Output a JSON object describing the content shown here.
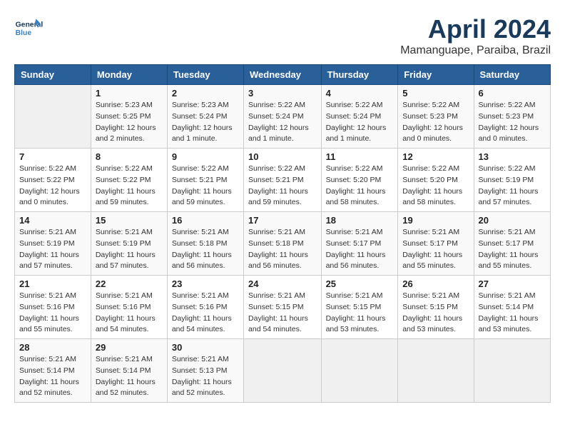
{
  "header": {
    "logo_general": "General",
    "logo_blue": "Blue",
    "month": "April 2024",
    "location": "Mamanguape, Paraiba, Brazil"
  },
  "columns": [
    "Sunday",
    "Monday",
    "Tuesday",
    "Wednesday",
    "Thursday",
    "Friday",
    "Saturday"
  ],
  "weeks": [
    [
      {
        "day": "",
        "sunrise": "",
        "sunset": "",
        "daylight": ""
      },
      {
        "day": "1",
        "sunrise": "Sunrise: 5:23 AM",
        "sunset": "Sunset: 5:25 PM",
        "daylight": "Daylight: 12 hours and 2 minutes."
      },
      {
        "day": "2",
        "sunrise": "Sunrise: 5:23 AM",
        "sunset": "Sunset: 5:24 PM",
        "daylight": "Daylight: 12 hours and 1 minute."
      },
      {
        "day": "3",
        "sunrise": "Sunrise: 5:22 AM",
        "sunset": "Sunset: 5:24 PM",
        "daylight": "Daylight: 12 hours and 1 minute."
      },
      {
        "day": "4",
        "sunrise": "Sunrise: 5:22 AM",
        "sunset": "Sunset: 5:24 PM",
        "daylight": "Daylight: 12 hours and 1 minute."
      },
      {
        "day": "5",
        "sunrise": "Sunrise: 5:22 AM",
        "sunset": "Sunset: 5:23 PM",
        "daylight": "Daylight: 12 hours and 0 minutes."
      },
      {
        "day": "6",
        "sunrise": "Sunrise: 5:22 AM",
        "sunset": "Sunset: 5:23 PM",
        "daylight": "Daylight: 12 hours and 0 minutes."
      }
    ],
    [
      {
        "day": "7",
        "sunrise": "Sunrise: 5:22 AM",
        "sunset": "Sunset: 5:22 PM",
        "daylight": "Daylight: 12 hours and 0 minutes."
      },
      {
        "day": "8",
        "sunrise": "Sunrise: 5:22 AM",
        "sunset": "Sunset: 5:22 PM",
        "daylight": "Daylight: 11 hours and 59 minutes."
      },
      {
        "day": "9",
        "sunrise": "Sunrise: 5:22 AM",
        "sunset": "Sunset: 5:21 PM",
        "daylight": "Daylight: 11 hours and 59 minutes."
      },
      {
        "day": "10",
        "sunrise": "Sunrise: 5:22 AM",
        "sunset": "Sunset: 5:21 PM",
        "daylight": "Daylight: 11 hours and 59 minutes."
      },
      {
        "day": "11",
        "sunrise": "Sunrise: 5:22 AM",
        "sunset": "Sunset: 5:20 PM",
        "daylight": "Daylight: 11 hours and 58 minutes."
      },
      {
        "day": "12",
        "sunrise": "Sunrise: 5:22 AM",
        "sunset": "Sunset: 5:20 PM",
        "daylight": "Daylight: 11 hours and 58 minutes."
      },
      {
        "day": "13",
        "sunrise": "Sunrise: 5:22 AM",
        "sunset": "Sunset: 5:19 PM",
        "daylight": "Daylight: 11 hours and 57 minutes."
      }
    ],
    [
      {
        "day": "14",
        "sunrise": "Sunrise: 5:21 AM",
        "sunset": "Sunset: 5:19 PM",
        "daylight": "Daylight: 11 hours and 57 minutes."
      },
      {
        "day": "15",
        "sunrise": "Sunrise: 5:21 AM",
        "sunset": "Sunset: 5:19 PM",
        "daylight": "Daylight: 11 hours and 57 minutes."
      },
      {
        "day": "16",
        "sunrise": "Sunrise: 5:21 AM",
        "sunset": "Sunset: 5:18 PM",
        "daylight": "Daylight: 11 hours and 56 minutes."
      },
      {
        "day": "17",
        "sunrise": "Sunrise: 5:21 AM",
        "sunset": "Sunset: 5:18 PM",
        "daylight": "Daylight: 11 hours and 56 minutes."
      },
      {
        "day": "18",
        "sunrise": "Sunrise: 5:21 AM",
        "sunset": "Sunset: 5:17 PM",
        "daylight": "Daylight: 11 hours and 56 minutes."
      },
      {
        "day": "19",
        "sunrise": "Sunrise: 5:21 AM",
        "sunset": "Sunset: 5:17 PM",
        "daylight": "Daylight: 11 hours and 55 minutes."
      },
      {
        "day": "20",
        "sunrise": "Sunrise: 5:21 AM",
        "sunset": "Sunset: 5:17 PM",
        "daylight": "Daylight: 11 hours and 55 minutes."
      }
    ],
    [
      {
        "day": "21",
        "sunrise": "Sunrise: 5:21 AM",
        "sunset": "Sunset: 5:16 PM",
        "daylight": "Daylight: 11 hours and 55 minutes."
      },
      {
        "day": "22",
        "sunrise": "Sunrise: 5:21 AM",
        "sunset": "Sunset: 5:16 PM",
        "daylight": "Daylight: 11 hours and 54 minutes."
      },
      {
        "day": "23",
        "sunrise": "Sunrise: 5:21 AM",
        "sunset": "Sunset: 5:16 PM",
        "daylight": "Daylight: 11 hours and 54 minutes."
      },
      {
        "day": "24",
        "sunrise": "Sunrise: 5:21 AM",
        "sunset": "Sunset: 5:15 PM",
        "daylight": "Daylight: 11 hours and 54 minutes."
      },
      {
        "day": "25",
        "sunrise": "Sunrise: 5:21 AM",
        "sunset": "Sunset: 5:15 PM",
        "daylight": "Daylight: 11 hours and 53 minutes."
      },
      {
        "day": "26",
        "sunrise": "Sunrise: 5:21 AM",
        "sunset": "Sunset: 5:15 PM",
        "daylight": "Daylight: 11 hours and 53 minutes."
      },
      {
        "day": "27",
        "sunrise": "Sunrise: 5:21 AM",
        "sunset": "Sunset: 5:14 PM",
        "daylight": "Daylight: 11 hours and 53 minutes."
      }
    ],
    [
      {
        "day": "28",
        "sunrise": "Sunrise: 5:21 AM",
        "sunset": "Sunset: 5:14 PM",
        "daylight": "Daylight: 11 hours and 52 minutes."
      },
      {
        "day": "29",
        "sunrise": "Sunrise: 5:21 AM",
        "sunset": "Sunset: 5:14 PM",
        "daylight": "Daylight: 11 hours and 52 minutes."
      },
      {
        "day": "30",
        "sunrise": "Sunrise: 5:21 AM",
        "sunset": "Sunset: 5:13 PM",
        "daylight": "Daylight: 11 hours and 52 minutes."
      },
      {
        "day": "",
        "sunrise": "",
        "sunset": "",
        "daylight": ""
      },
      {
        "day": "",
        "sunrise": "",
        "sunset": "",
        "daylight": ""
      },
      {
        "day": "",
        "sunrise": "",
        "sunset": "",
        "daylight": ""
      },
      {
        "day": "",
        "sunrise": "",
        "sunset": "",
        "daylight": ""
      }
    ]
  ]
}
